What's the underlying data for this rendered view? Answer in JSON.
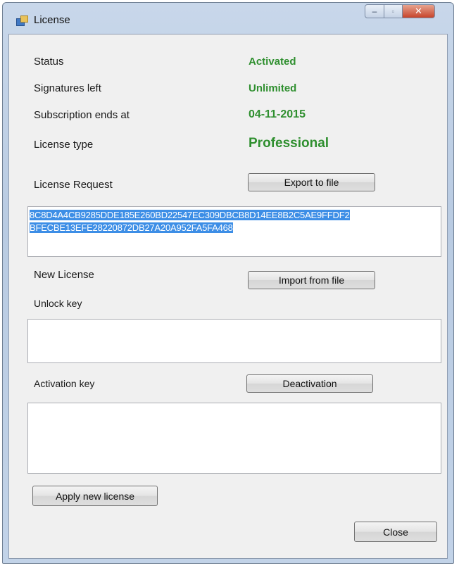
{
  "window": {
    "title": "License",
    "minimize_glyph": "‒",
    "maximize_glyph": "▫",
    "close_glyph": "✕"
  },
  "colors": {
    "value_green": "#2f8f2f",
    "selection_blue": "#3d8ee6"
  },
  "icons": {
    "app": "license-app-icon"
  },
  "info": {
    "status_label": "Status",
    "status_value": "Activated",
    "signatures_label": "Signatures left",
    "signatures_value": "Unlimited",
    "subscription_label": "Subscription ends at",
    "subscription_value": "04-11-2015",
    "license_type_label": "License type",
    "license_type_value": "Professional"
  },
  "request": {
    "label": "License Request",
    "export_button": "Export to file",
    "text_line1": "8C8D4A4CB9285DDE185E260BD22547EC309DBCB8D14EE8B2C5AE9FFDF2",
    "text_line2": "BFECBE13EFE28220872DB27A20A952FA5FA468"
  },
  "new_license": {
    "label": "New License",
    "import_button": "Import from file",
    "unlock_key_label": "Unlock key",
    "unlock_key_value": "",
    "activation_key_label": "Activation key",
    "deactivation_button": "Deactivation",
    "activation_key_value": ""
  },
  "footer": {
    "apply_button": "Apply new license",
    "close_button": "Close"
  }
}
